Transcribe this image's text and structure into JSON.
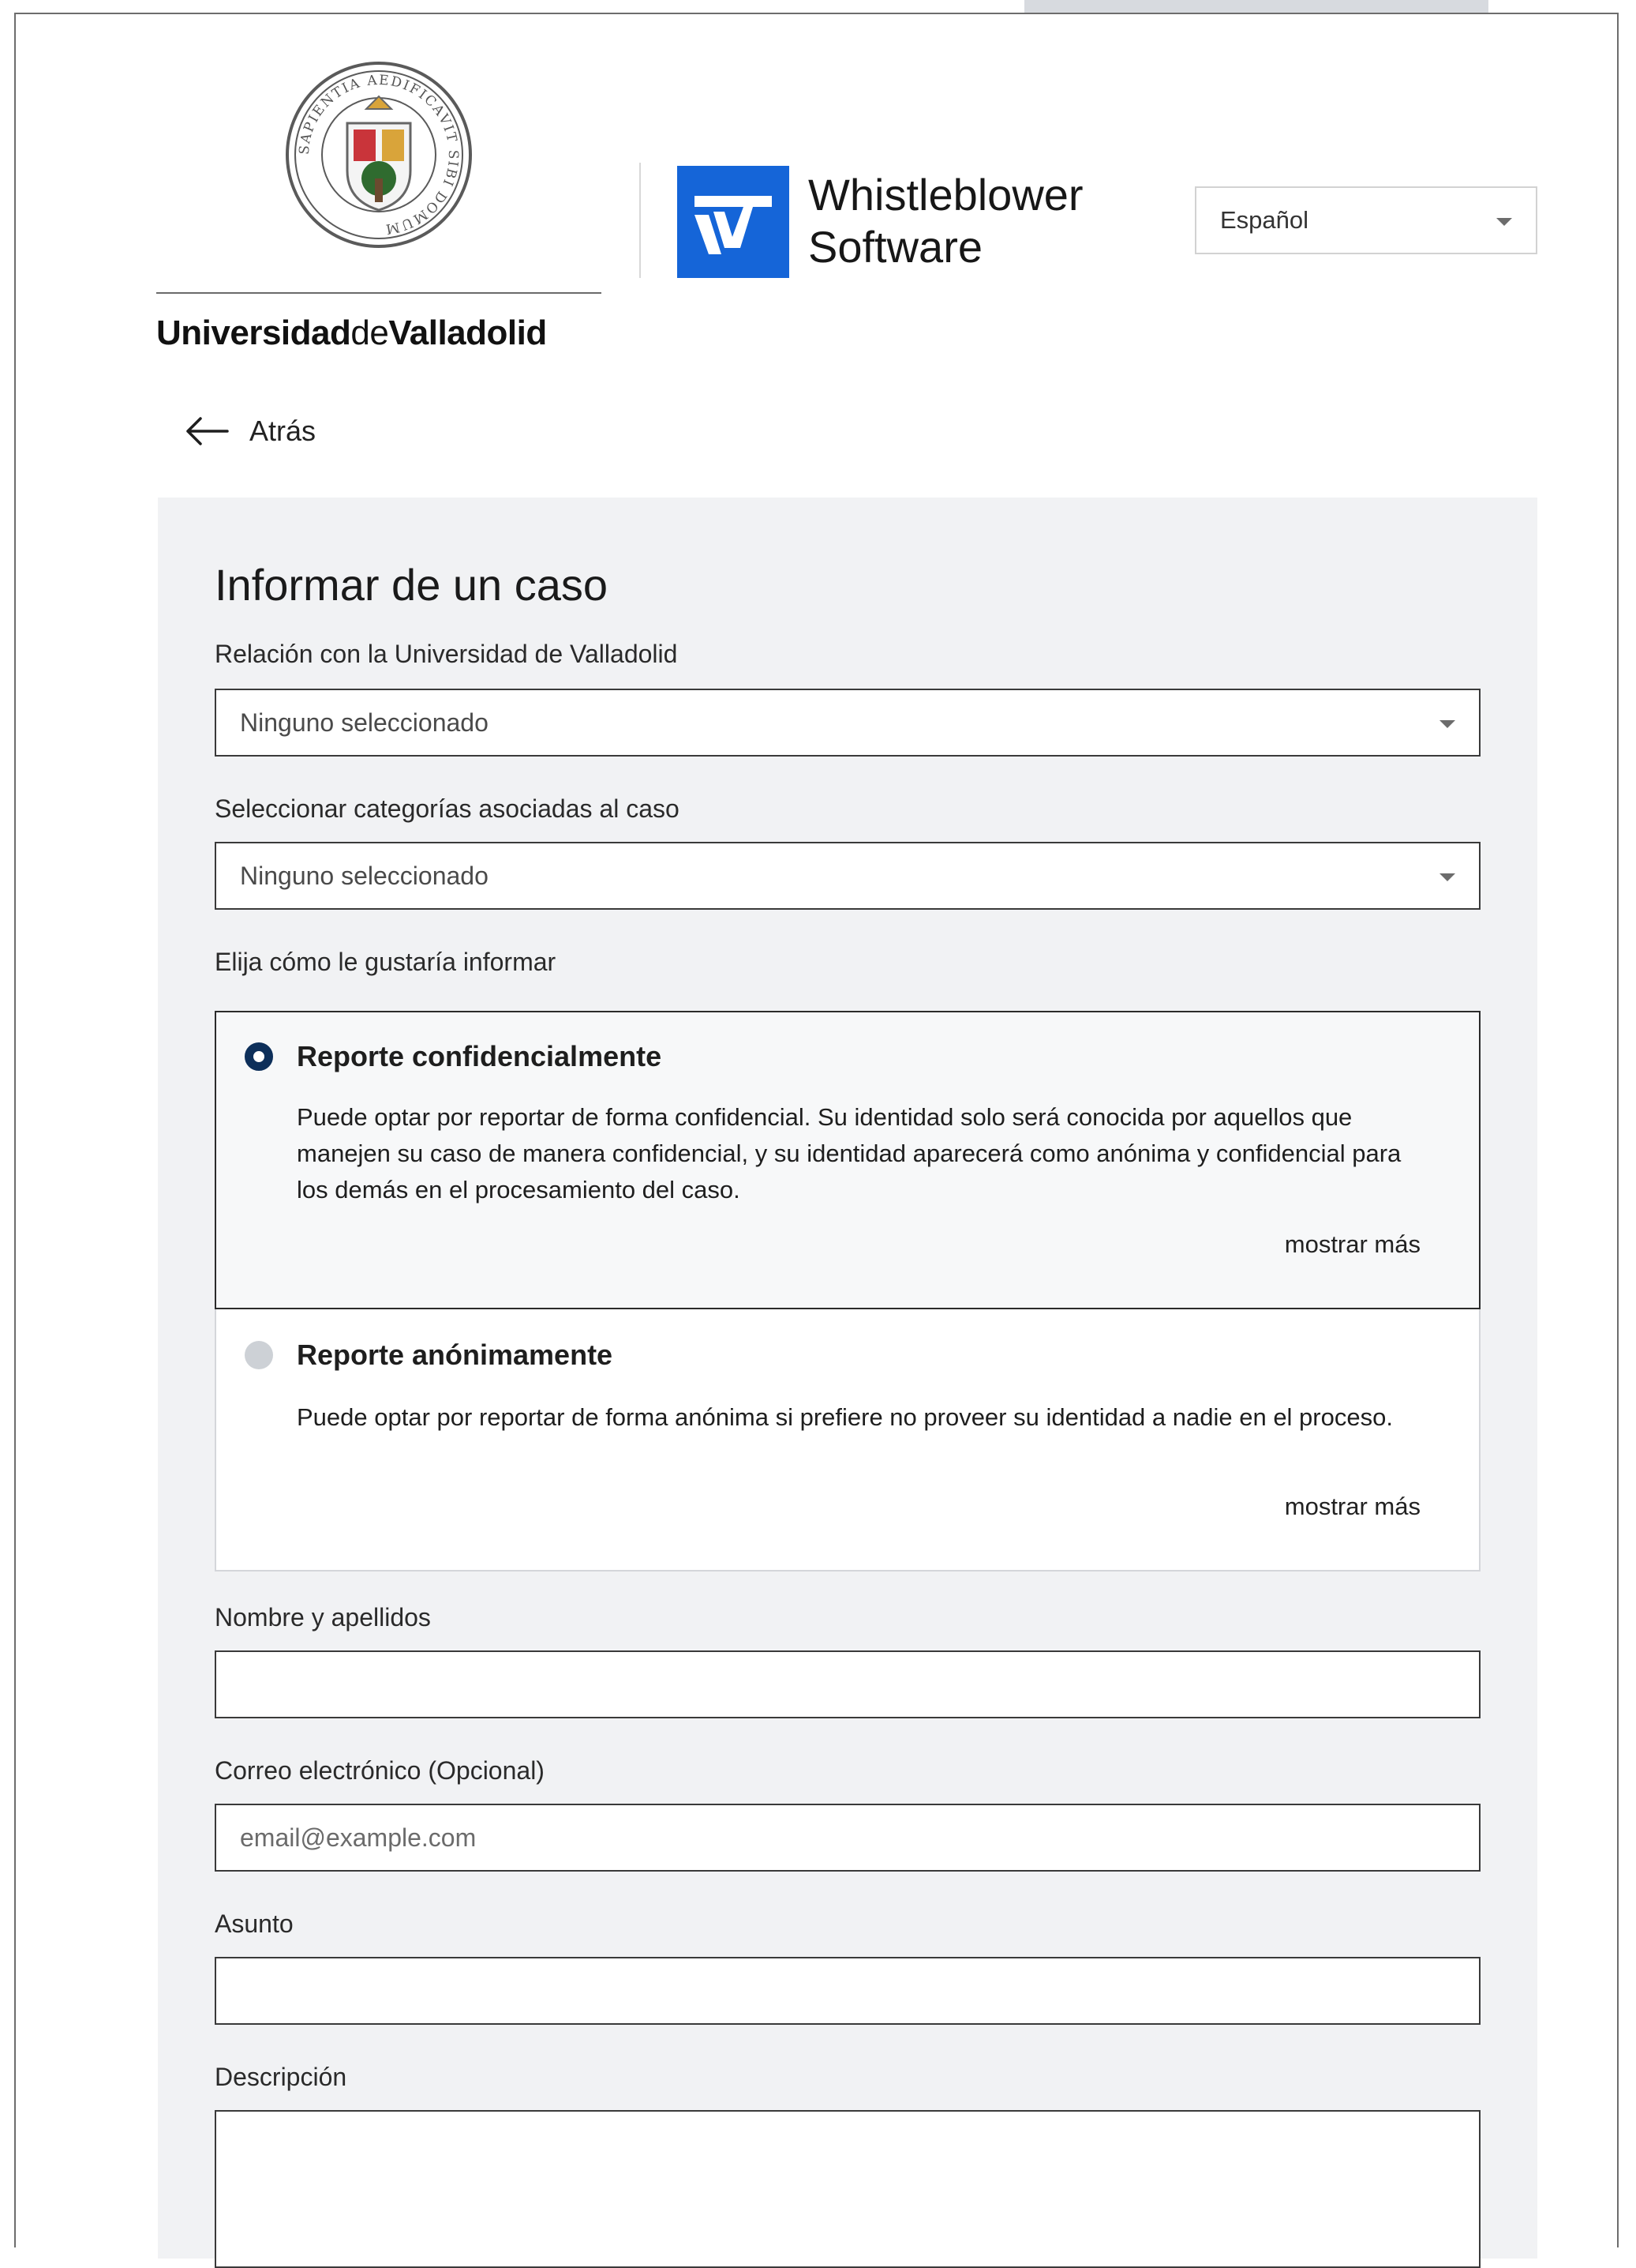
{
  "header": {
    "university_name_part1": "Universidad",
    "university_name_part2": "de",
    "university_name_part3": "Valladolid",
    "seal_legend": "SAPIENTIA AEDIFICAVIT SIBI DOMUM",
    "brand_name_line1": "Whistleblower",
    "brand_name_line2": "Software",
    "language_selected": "Español",
    "colors": {
      "brand_blue": "#1565d8",
      "radio_selected": "#0d2f5a"
    }
  },
  "nav": {
    "back_label": "Atrás",
    "back_icon": "arrow-left-icon"
  },
  "form": {
    "title": "Informar de un caso",
    "relation": {
      "label": "Relación con la Universidad de Valladolid",
      "value": "Ninguno seleccionado"
    },
    "categories": {
      "label": "Seleccionar categorías asociadas al caso",
      "value": "Ninguno seleccionado"
    },
    "report_mode": {
      "label": "Elija cómo le gustaría informar",
      "options": [
        {
          "title": "Reporte confidencialmente",
          "description": "Puede optar por reportar de forma confidencial. Su identidad solo será conocida por aquellos que manejen su caso de manera confidencial, y su identidad aparecerá como anónima y confidencial para los demás en el procesamiento del caso.",
          "show_more": "mostrar más",
          "selected": true
        },
        {
          "title": "Reporte anónimamente",
          "description": "Puede optar por reportar de forma anónima si prefiere no proveer su identidad a nadie en el proceso.",
          "show_more": "mostrar más",
          "selected": false
        }
      ]
    },
    "name": {
      "label": "Nombre y apellidos",
      "value": ""
    },
    "email": {
      "label": "Correo electrónico (Opcional)",
      "placeholder": "email@example.com"
    },
    "subject": {
      "label": "Asunto",
      "value": ""
    },
    "description": {
      "label": "Descripción",
      "value": ""
    }
  }
}
